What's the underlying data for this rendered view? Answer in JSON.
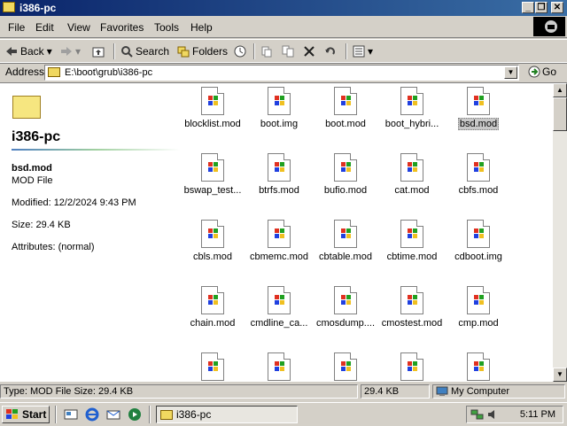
{
  "window": {
    "title": "i386-pc"
  },
  "menu": [
    "File",
    "Edit",
    "View",
    "Favorites",
    "Tools",
    "Help"
  ],
  "toolbar": {
    "back": "Back",
    "search": "Search",
    "folders": "Folders"
  },
  "address": {
    "label": "Address",
    "value": "E:\\boot\\grub\\i386-pc",
    "go": "Go"
  },
  "left_panel": {
    "folder_title": "i386-pc",
    "selected_name": "bsd.mod",
    "selected_type": "MOD File",
    "modified": "Modified: 12/2/2024 9:43 PM",
    "size": "Size: 29.4 KB",
    "attributes": "Attributes: (normal)"
  },
  "files": [
    "blocklist.mod",
    "boot.img",
    "boot.mod",
    "boot_hybri...",
    "bsd.mod",
    "bswap_test...",
    "btrfs.mod",
    "bufio.mod",
    "cat.mod",
    "cbfs.mod",
    "cbls.mod",
    "cbmemc.mod",
    "cbtable.mod",
    "cbtime.mod",
    "cdboot.img",
    "chain.mod",
    "cmdline_ca...",
    "cmosdump....",
    "cmostest.mod",
    "cmp.mod",
    "",
    "",
    "",
    "",
    ""
  ],
  "selected_file": "bsd.mod",
  "status": {
    "left": "Type: MOD File Size: 29.4 KB",
    "size": "29.4 KB",
    "zone": "My Computer"
  },
  "taskbar": {
    "start": "Start",
    "task": "i386-pc",
    "clock": "5:11 PM"
  }
}
